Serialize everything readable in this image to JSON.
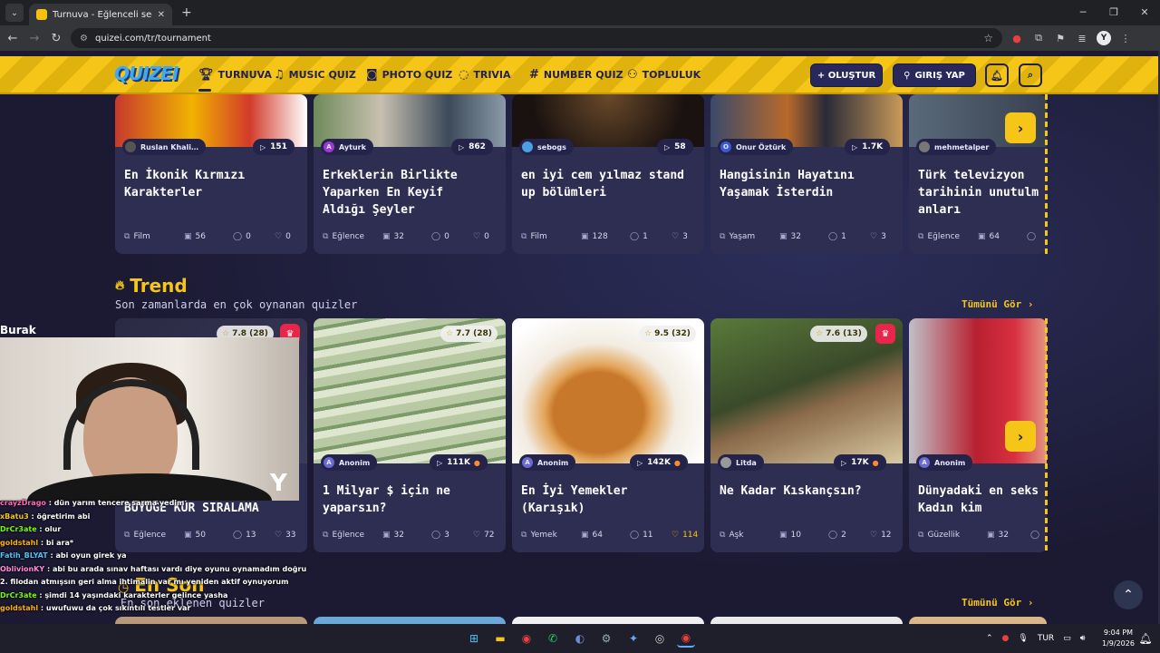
{
  "browser": {
    "tab_title": "Turnuva - Eğlenceli seçimler ya",
    "url": "quizei.com/tr/tournament",
    "profile_initial": "Y"
  },
  "header": {
    "logo": "QUIZEI",
    "nav": [
      "TURNUVA",
      "MUSIC QUIZ",
      "PHOTO QUIZ",
      "TRIVIA",
      "NUMBER QUIZ",
      "TOPLULUK"
    ],
    "create_label": "+ OLUŞTUR",
    "login_label": "GIRIŞ YAP"
  },
  "top_row": [
    {
      "author": "Ruslan Khali…",
      "plays": "151",
      "title": "En İkonik Kırmızı\nKarakterler",
      "category": "Film",
      "questions": "56",
      "comments": "0",
      "likes": "0"
    },
    {
      "author": "Ayturk",
      "plays": "862",
      "title": "Erkeklerin Birlikte\nYaparken En Keyif\nAldığı Şeyler",
      "category": "Eğlence",
      "questions": "32",
      "comments": "0",
      "likes": "0"
    },
    {
      "author": "sebogs",
      "plays": "58",
      "title": "en iyi cem yılmaz stand\nup bölümleri",
      "category": "Film",
      "questions": "128",
      "comments": "1",
      "likes": "3"
    },
    {
      "author": "Onur Öztürk",
      "plays": "1.7K",
      "title": "Hangisinin Hayatını\nYaşamak İsterdin",
      "category": "Yaşam",
      "questions": "32",
      "comments": "1",
      "likes": "3"
    },
    {
      "author": "mehmetalper",
      "plays": "",
      "title": "Türk televizyon\ntarihinin unutulm\nanları",
      "category": "Eğlence",
      "questions": "64",
      "comments": "",
      "likes": ""
    }
  ],
  "trend": {
    "title": "Trend",
    "subtitle": "Son zamanlarda en çok oynanan quizler",
    "see_all": "Tümünü Gör ›",
    "cards": [
      {
        "rating": "7.8",
        "votes": "(28)",
        "author": "",
        "plays": "",
        "title": "BÜYÜĞE KÜR SIRALAMA",
        "category": "Eğlence",
        "questions": "50",
        "comments": "13",
        "likes": "33"
      },
      {
        "rating": "7.7",
        "votes": "(28)",
        "author": "Anonim",
        "plays": "111K",
        "title": "1 Milyar $ için ne\nyaparsın?",
        "category": "Eğlence",
        "questions": "32",
        "comments": "3",
        "likes": "72"
      },
      {
        "rating": "9.5",
        "votes": "(32)",
        "author": "Anonim",
        "plays": "142K",
        "title": "En İyi Yemekler\n(Karışık)",
        "category": "Yemek",
        "questions": "64",
        "comments": "11",
        "likes": "114"
      },
      {
        "rating": "7.6",
        "votes": "(13)",
        "author": "Litda",
        "plays": "17K",
        "title": "Ne Kadar Kıskançsın?",
        "category": "Aşk",
        "questions": "10",
        "comments": "2",
        "likes": "12"
      },
      {
        "rating": "",
        "votes": "",
        "author": "Anonim",
        "plays": "",
        "title": "Dünyadaki en seks\nKadın kim",
        "category": "Güzellik",
        "questions": "32",
        "comments": "",
        "likes": ""
      }
    ]
  },
  "latest": {
    "title": "En Son",
    "subtitle": "En son eklenen quizler",
    "see_all": "Tümünü Gör ›"
  },
  "stream": {
    "cam_name": "Burak",
    "chat": [
      {
        "user": "crayzDrago",
        "color": "#ff69b4",
        "msg": "dün yarım tencere sarma yedim"
      },
      {
        "user": "xBatu3",
        "color": "#f5c518",
        "msg": "öğretirim abi"
      },
      {
        "user": "DrCr3ate",
        "color": "#7cfc00",
        "msg": "olur"
      },
      {
        "user": "goldstahl",
        "color": "#ffb000",
        "msg": "bi ara*"
      },
      {
        "user": "Fatih_BLYAT",
        "color": "#4fc3f7",
        "msg": "abi oyun girek ya"
      },
      {
        "user": "OblivionKY",
        "color": "#ff8ad8",
        "msg": "abi bu arada sınav haftası vardı diye oyunu oynamadım doğru düzgün"
      },
      {
        "user": "",
        "color": "#ffffff",
        "msg": "2. filodan atmışsın geri alma ihtimalin var mı yeniden aktif oynuyorum"
      },
      {
        "user": "DrCr3ate",
        "color": "#7cfc00",
        "msg": "şimdi 14 yaşındaki karakterler gelince yasha"
      },
      {
        "user": "goldstahl",
        "color": "#ffb000",
        "msg": "uwufuwu da çok sıkıntılı testler var"
      }
    ]
  },
  "taskbar": {
    "lang": "TUR",
    "time": "9:04 PM",
    "date": "1/9/2026"
  }
}
